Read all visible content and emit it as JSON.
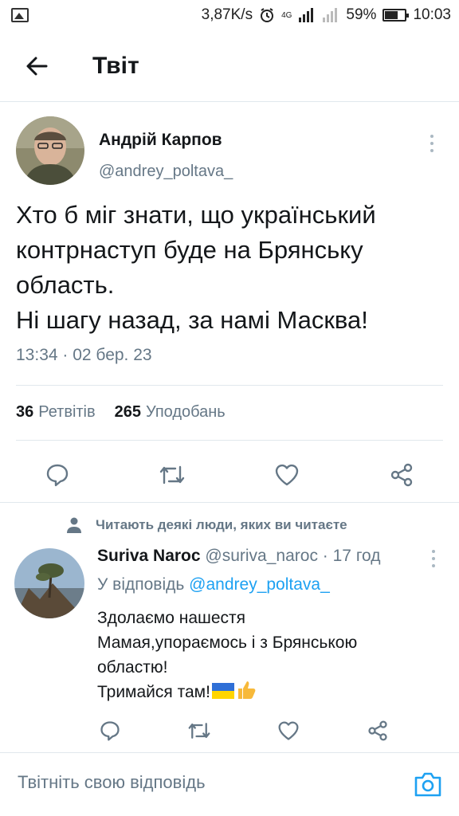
{
  "status_bar": {
    "speed": "3,87K/s",
    "network": "4G",
    "battery": "59%",
    "time": "10:03"
  },
  "header": {
    "title": "Твіт"
  },
  "tweet": {
    "author_name": "Андрій Карпов",
    "author_handle": "@andrey_poltava_",
    "text_lines": [
      "Хто б міг знати, що український",
      "контрнаступ буде на Брянську",
      "область.",
      "Ні шагу назад, за намі Масква!"
    ],
    "timestamp": "13:34 · 02 бер. 23",
    "retweets_count": "36",
    "retweets_label": "Ретвітів",
    "likes_count": "265",
    "likes_label": "Уподобань"
  },
  "reply": {
    "social_context": "Читають деякі люди, яких ви читаєте",
    "author_name": "Suriva Naroc",
    "author_handle": "@suriva_naroc",
    "time": "· 17 год",
    "reply_to_prefix": "У відповідь",
    "reply_to_handle": "@andrey_poltava_",
    "text_lines": [
      "Здолаємо нашестя",
      "Мамая,упораємось і з Брянською",
      "областю!",
      "Тримайся там!"
    ]
  },
  "compose": {
    "placeholder": "Твітніть свою відповідь"
  },
  "colors": {
    "accent": "#1da1f2",
    "secondary_text": "#657786",
    "icon_gray": "#657786",
    "divider": "#e1e8ed"
  }
}
